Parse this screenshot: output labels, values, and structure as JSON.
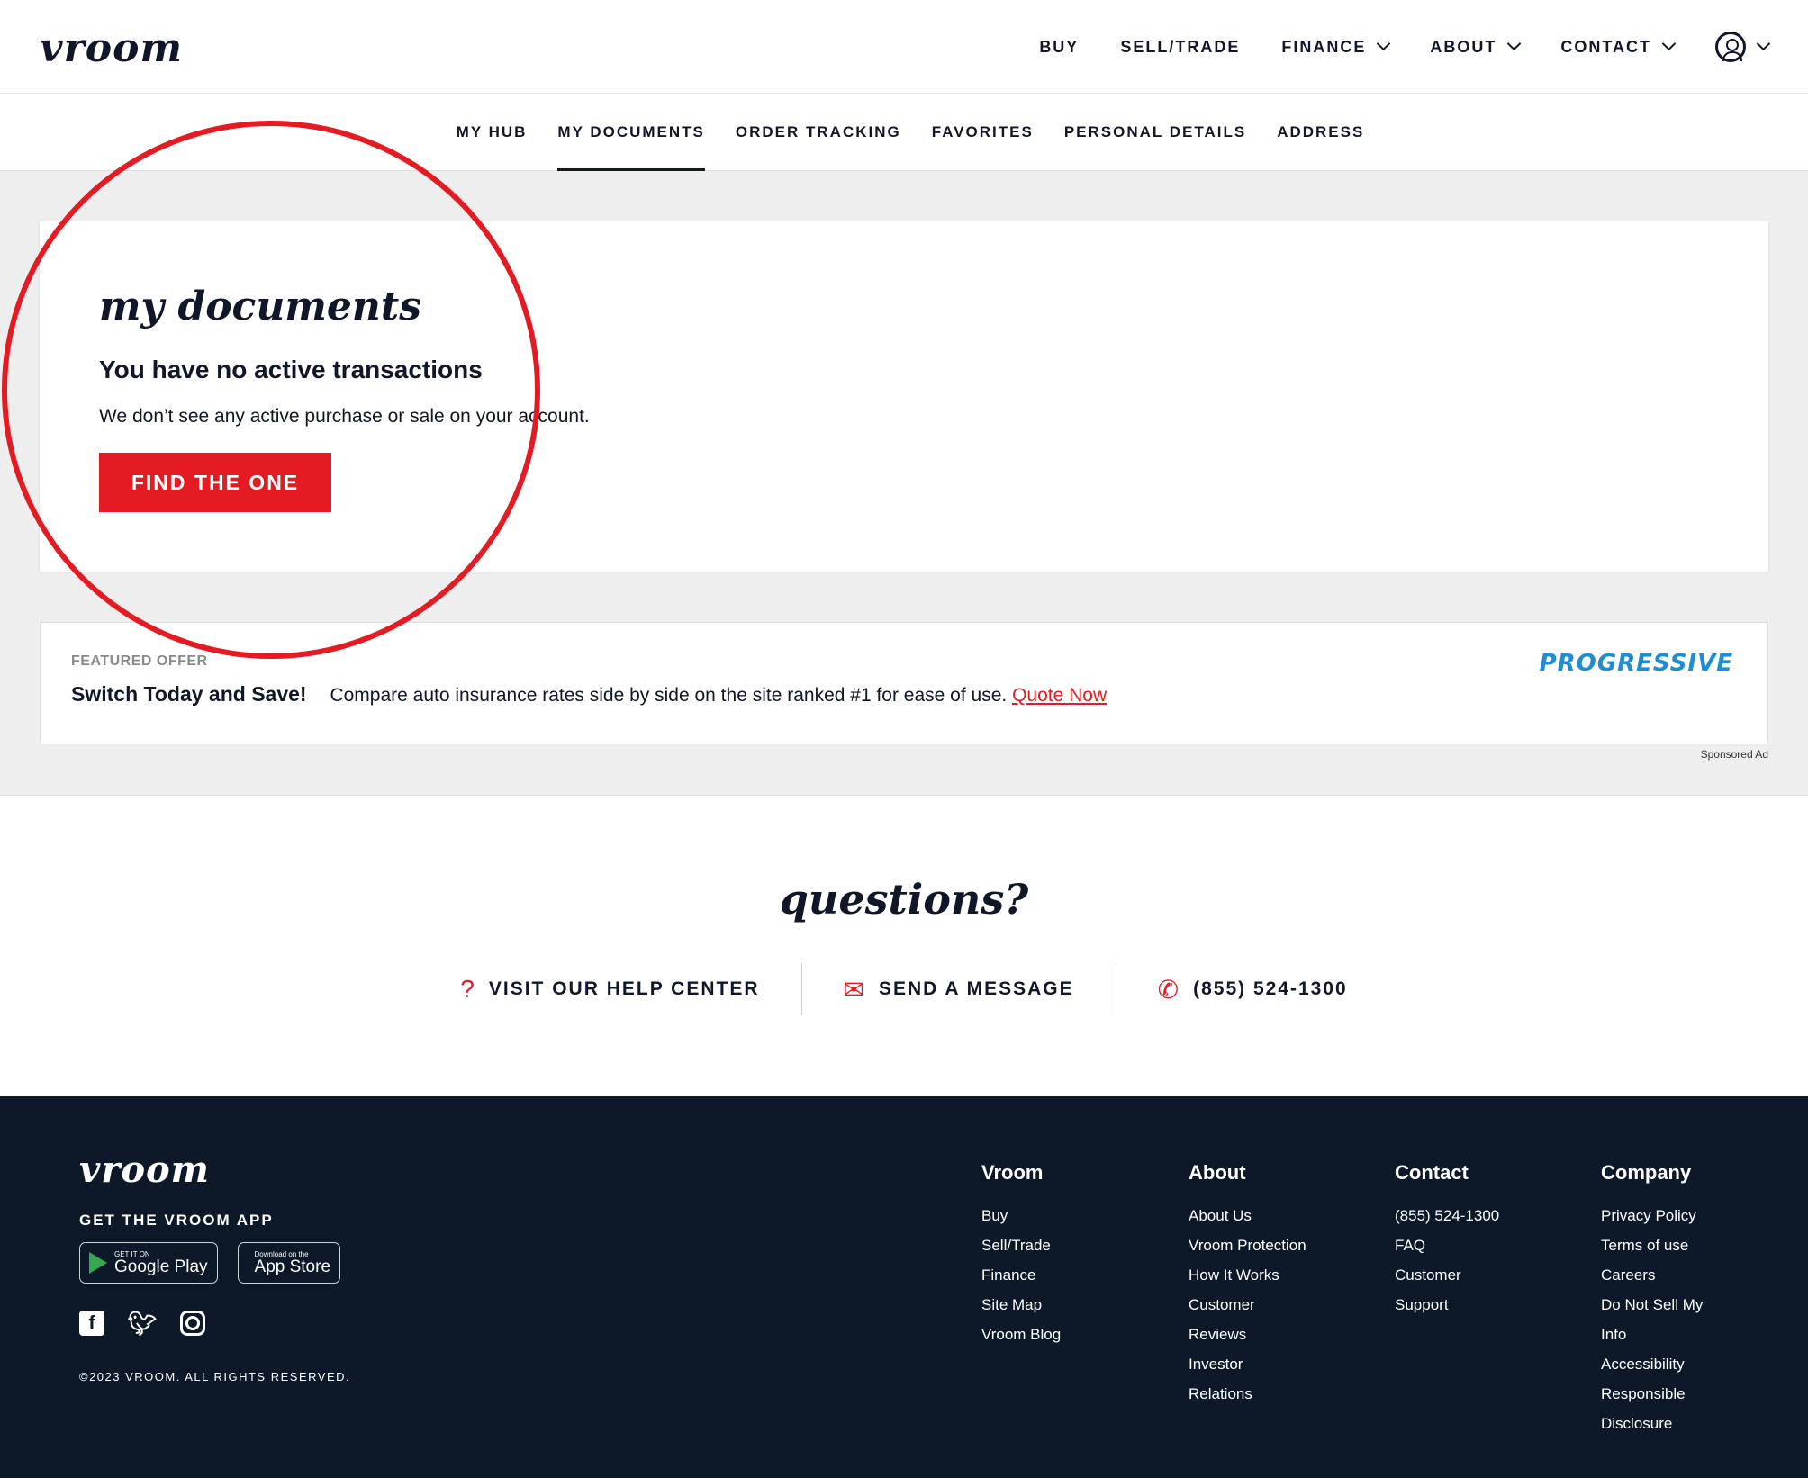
{
  "brand": {
    "logo_text": "vroom"
  },
  "nav": {
    "items": [
      {
        "label": "BUY",
        "has_menu": false
      },
      {
        "label": "SELL/TRADE",
        "has_menu": false
      },
      {
        "label": "FINANCE",
        "has_menu": true
      },
      {
        "label": "ABOUT",
        "has_menu": true
      },
      {
        "label": "CONTACT",
        "has_menu": true
      }
    ],
    "account_icon": "user-circle-icon"
  },
  "subnav": {
    "tabs": [
      {
        "label": "MY HUB",
        "active": false
      },
      {
        "label": "MY DOCUMENTS",
        "active": true
      },
      {
        "label": "ORDER TRACKING",
        "active": false
      },
      {
        "label": "FAVORITES",
        "active": false
      },
      {
        "label": "PERSONAL DETAILS",
        "active": false
      },
      {
        "label": "ADDRESS",
        "active": false
      }
    ]
  },
  "documents": {
    "title": "my documents",
    "heading": "You have no active transactions",
    "message": "We don’t see any active purchase or sale on your account.",
    "cta_label": "FIND THE ONE"
  },
  "offer": {
    "tag": "FEATURED OFFER",
    "headline": "Switch Today and Save!",
    "text": "Compare auto insurance rates side by side on the site ranked #1 for ease of use.",
    "link_label": "Quote Now",
    "brand": "PROGRESSIVE",
    "sponsored": "Sponsored Ad"
  },
  "questions": {
    "title": "questions?",
    "links": [
      {
        "icon": "question-mark-icon",
        "label": "VISIT OUR HELP CENTER"
      },
      {
        "icon": "envelope-icon",
        "label": "SEND A MESSAGE"
      },
      {
        "icon": "phone-icon",
        "label": "(855) 524-1300"
      }
    ]
  },
  "footer": {
    "logo_text": "vroom",
    "app_heading": "GET THE VROOM APP",
    "google_play": {
      "small": "GET IT ON",
      "big": "Google Play"
    },
    "app_store": {
      "small": "Download on the",
      "big": "App Store"
    },
    "social": [
      "facebook-icon",
      "twitter-icon",
      "instagram-icon"
    ],
    "copyright": "©2023 VROOM. ALL RIGHTS RESERVED.",
    "columns": [
      {
        "title": "Vroom",
        "links": [
          "Buy",
          "Sell/Trade",
          "Finance",
          "Site Map",
          "Vroom Blog"
        ]
      },
      {
        "title": "About",
        "links": [
          "About Us",
          "Vroom Protection",
          "How It Works",
          "Customer",
          "Reviews",
          "Investor",
          "Relations"
        ]
      },
      {
        "title": "Contact",
        "links": [
          "(855) 524-1300",
          "FAQ",
          "Customer",
          "Support"
        ]
      },
      {
        "title": "Company",
        "links": [
          "Privacy Policy",
          "Terms of use",
          "Careers",
          "Do Not Sell My",
          "Info",
          "Accessibility",
          "Responsible",
          "Disclosure"
        ]
      }
    ]
  },
  "colors": {
    "accent": "#e41b23",
    "navy": "#0d1829",
    "progressive_blue": "#1e8dd4"
  }
}
